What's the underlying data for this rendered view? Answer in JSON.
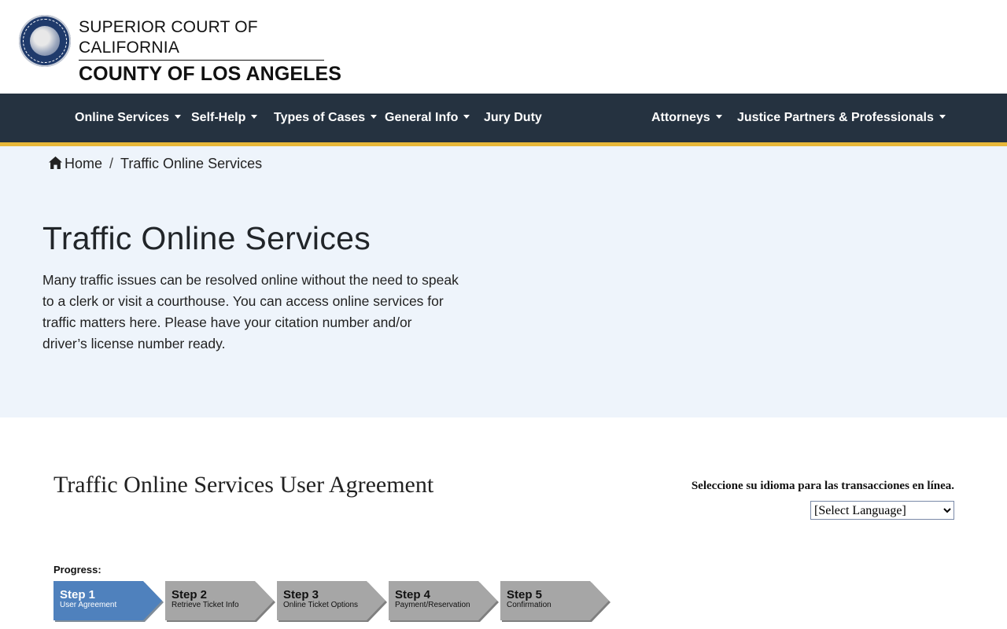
{
  "header": {
    "line1": "SUPERIOR COURT OF CALIFORNIA",
    "line2": "COUNTY OF LOS ANGELES"
  },
  "nav": {
    "items": [
      {
        "label": "Online Services",
        "dropdown": true
      },
      {
        "label": "Self-Help",
        "dropdown": true
      },
      {
        "label": "Types of Cases",
        "dropdown": true
      },
      {
        "label": "General Info",
        "dropdown": true
      },
      {
        "label": "Jury Duty",
        "dropdown": false
      },
      {
        "label": "Attorneys",
        "dropdown": true
      },
      {
        "label": "Justice Partners & Professionals",
        "dropdown": true
      }
    ]
  },
  "breadcrumb": {
    "home": "Home",
    "separator": "/",
    "current": "Traffic Online Services"
  },
  "hero": {
    "title": "Traffic Online Services",
    "description": "Many traffic issues can be resolved online without the need to speak to a clerk or visit a courthouse. You can access online services for traffic matters here. Please have your citation number and/or driver’s license number ready."
  },
  "agreement": {
    "title": "Traffic Online Services User Agreement",
    "language_label": "Seleccione su idioma para las transacciones en línea.",
    "language_select": "[Select Language]"
  },
  "progress": {
    "label": "Progress:",
    "steps": [
      {
        "title": "Step 1",
        "subtitle": "User Agreement",
        "active": true
      },
      {
        "title": "Step 2",
        "subtitle": "Retrieve Ticket Info",
        "active": false
      },
      {
        "title": "Step 3",
        "subtitle": "Online Ticket Options",
        "active": false
      },
      {
        "title": "Step 4",
        "subtitle": "Payment/Reservation",
        "active": false
      },
      {
        "title": "Step 5",
        "subtitle": "Confirmation",
        "active": false
      }
    ]
  },
  "colors": {
    "nav_bg": "#253240",
    "nav_accent": "#e8b839",
    "hero_bg": "#eef4fb",
    "step_active": "#4f81bd",
    "step_inactive": "#a6a6a6"
  }
}
